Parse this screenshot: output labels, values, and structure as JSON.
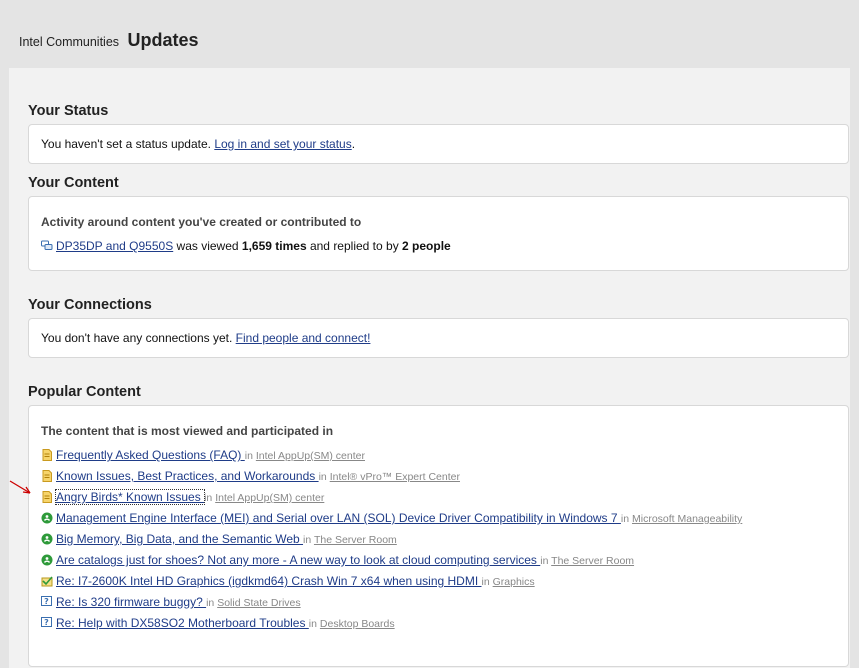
{
  "header": {
    "site": "Intel Communities",
    "title": "Updates"
  },
  "status": {
    "heading": "Your Status",
    "text": "You haven't set a status update. ",
    "link": "Log in and set your status",
    "suffix": "."
  },
  "content": {
    "heading": "Your Content",
    "subheading": "Activity around content you've created or contributed to",
    "item": {
      "icon": "discussion-icon",
      "link": "DP35DP and Q9550S",
      "text1": " was viewed ",
      "views": "1,659 times",
      "text2": " and replied to by ",
      "people": "2 people"
    }
  },
  "connections": {
    "heading": "Your Connections",
    "text": "You don't have any connections yet. ",
    "link": "Find people and connect!"
  },
  "popular": {
    "heading": "Popular Content",
    "subheading": "The content that is most viewed and participated in",
    "in_label": "in",
    "items": [
      {
        "icon": "document-icon",
        "title": "Frequently Asked Questions (FAQ) ",
        "place": "Intel AppUp(SM) center"
      },
      {
        "icon": "document-icon",
        "title": "Known Issues, Best Practices, and Workarounds ",
        "place": "Intel® vPro™ Expert Center"
      },
      {
        "icon": "document-icon",
        "title": "Angry Birds* Known Issues ",
        "place": "Intel AppUp(SM) center"
      },
      {
        "icon": "blog-icon",
        "title": "Management Engine Interface (MEI) and Serial over LAN (SOL) Device Driver Compatibility in Windows 7 ",
        "place": "Microsoft Manageability"
      },
      {
        "icon": "blog-icon",
        "title": "Big Memory, Big Data, and the Semantic Web ",
        "place": "The Server Room"
      },
      {
        "icon": "blog-icon",
        "title": "Are catalogs just for shoes? Not any more - A new way to look at cloud computing services ",
        "place": "The Server Room"
      },
      {
        "icon": "answered-question-icon",
        "title": "Re: I7-2600K Intel HD Graphics (igdkmd64) Crash Win 7 x64 when using HDMI ",
        "place": "Graphics"
      },
      {
        "icon": "question-icon",
        "title": "Re: Is 320 firmware buggy? ",
        "place": "Solid State Drives"
      },
      {
        "icon": "question-icon",
        "title": "Re: Help with DX58SO2 Motherboard Troubles ",
        "place": "Desktop Boards"
      }
    ]
  },
  "colors": {
    "link": "#1f3c88",
    "place": "#888888",
    "arrow": "#cc0000"
  }
}
